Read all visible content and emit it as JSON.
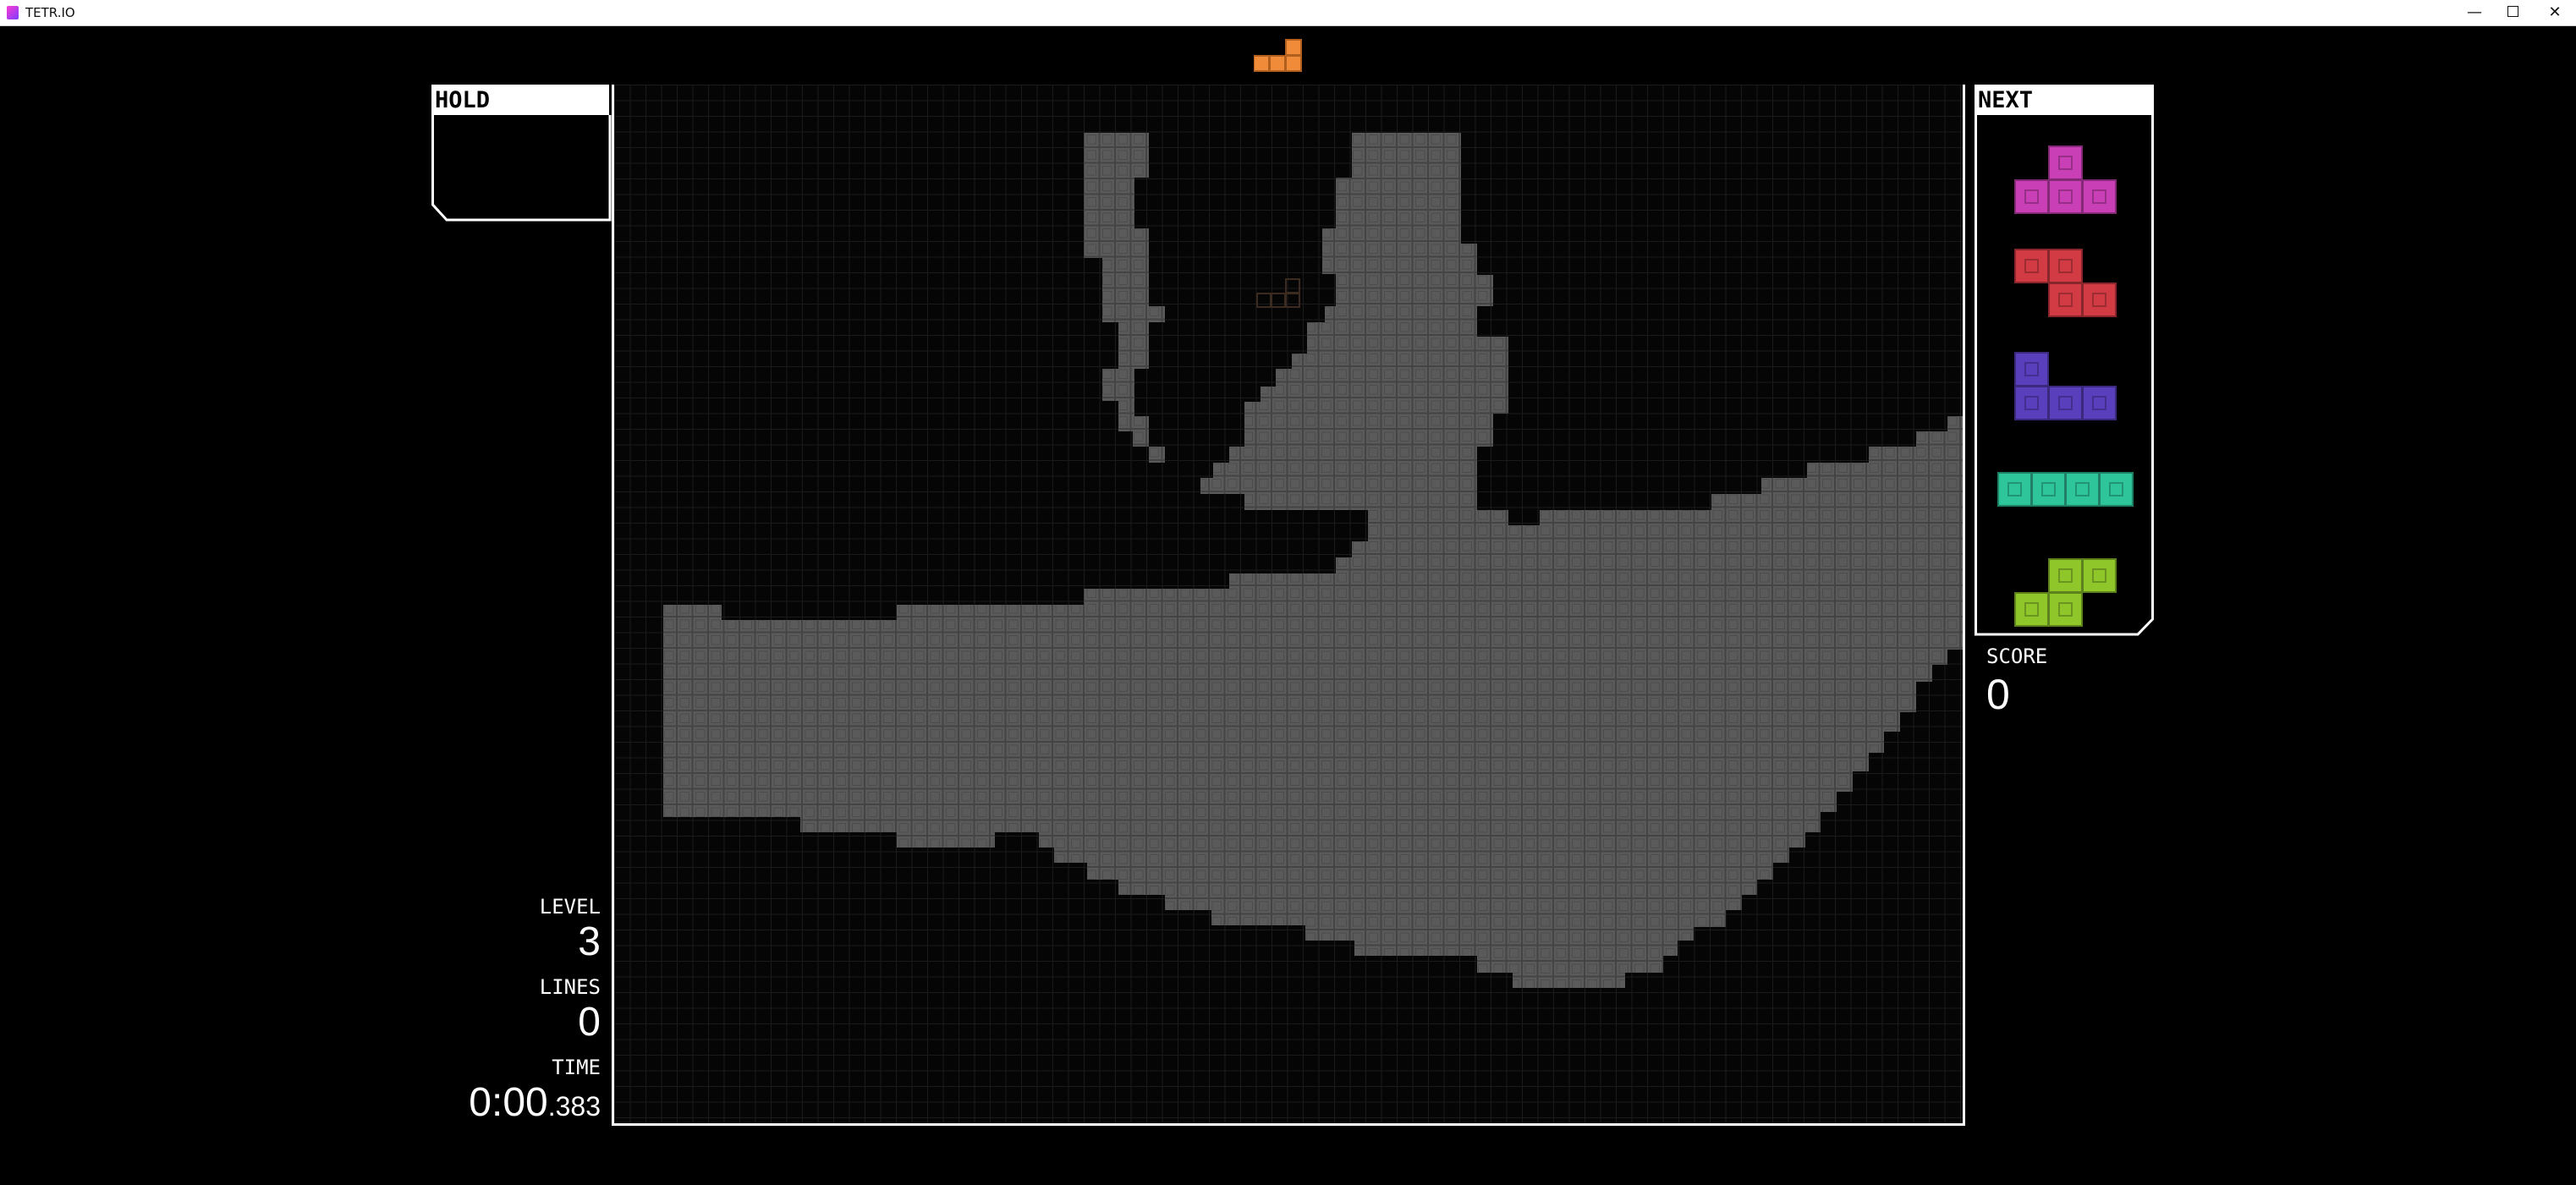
{
  "window": {
    "title": "TETR.IO"
  },
  "hold": {
    "label": "HOLD"
  },
  "next": {
    "label": "NEXT",
    "queue": [
      {
        "piece": "T",
        "color": "#c93fb6"
      },
      {
        "piece": "Z",
        "color": "#d23a44"
      },
      {
        "piece": "J",
        "color": "#5a3fbd"
      },
      {
        "piece": "I",
        "color": "#2fc59b"
      },
      {
        "piece": "S",
        "color": "#8fc62a"
      }
    ]
  },
  "stats": {
    "level_label": "LEVEL",
    "level": "3",
    "lines_label": "LINES",
    "lines": "0",
    "time_label": "TIME",
    "time": "0:00",
    "time_ms": ".383",
    "score_label": "SCORE",
    "score": "0"
  },
  "active_piece": {
    "piece": "L",
    "color": "#f08b3a"
  },
  "garbage_color": "#5a5a5a"
}
